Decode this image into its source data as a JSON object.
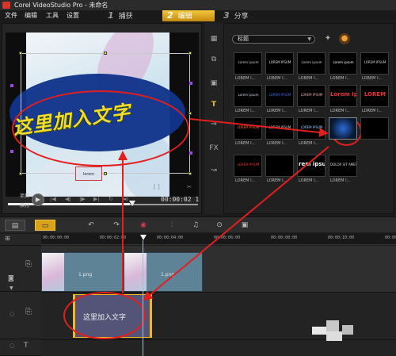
{
  "window": {
    "title": "Corel VideoStudio Pro - 未命名"
  },
  "menu": {
    "items": [
      "文件",
      "编辑",
      "工具",
      "设置"
    ]
  },
  "steps": [
    {
      "num": "1",
      "label": "捕获"
    },
    {
      "num": "2",
      "label": "编辑"
    },
    {
      "num": "3",
      "label": "分享"
    }
  ],
  "preview": {
    "overlay_text": "这里加入文字",
    "small_box_text": "lorem",
    "mode_project": "项目",
    "mode_clip": "素材",
    "timecode": "00:00:02 1"
  },
  "library": {
    "category": "标题",
    "thumbnails": [
      {
        "text": "Lorem ipsum",
        "label": "LOREM I..."
      },
      {
        "text": "LOREM IPSUM",
        "label": "LOREM I..."
      },
      {
        "text": "Lorem ipsum",
        "label": "LOREM I..."
      },
      {
        "text": "Lorem ipsum",
        "label": "LOREM I..."
      },
      {
        "text": "LOREM IPSUM",
        "label": "LOREM I..."
      },
      {
        "text": "Lorem ipsum",
        "label": "LOREM I..."
      },
      {
        "text": "LOREM IPSUM",
        "label": "LOREM I..."
      },
      {
        "text": "LOREM IPSUM",
        "label": "LOREM I..."
      },
      {
        "text": "Lorem Ipsum",
        "label": "LOREM I..."
      },
      {
        "text": "LOREM",
        "label": "LOREM I..."
      },
      {
        "text": "LOREM IPSUM",
        "label": "LOREM I..."
      },
      {
        "text": "LOREM IPSUM",
        "label": "LOREM I..."
      },
      {
        "text": "LOREM IPSUM",
        "label": "LOREM I..."
      },
      {
        "text": "",
        "label": ""
      },
      {
        "text": "",
        "label": ""
      },
      {
        "text": "LOREM IPSUM",
        "label": "LOREM I..."
      },
      {
        "text": "",
        "label": "LOREM I..."
      },
      {
        "text": "rem ipsu OR SIT A",
        "label": "LOREM I..."
      },
      {
        "text": "DOLOR SIT AMET",
        "label": "LOREM I..."
      }
    ]
  },
  "timeline": {
    "ruler_ticks": [
      "00:00:00:00",
      "00:00:02:00",
      "00:00:04:00",
      "00:00:06:00",
      "00:00:08:00",
      "00:00:10:00",
      "00:00:12:00"
    ],
    "video_clips": [
      {
        "label": "1.png"
      },
      {
        "label": "1.png"
      }
    ],
    "title_clip_label": "这里加入文字"
  },
  "colors": {
    "accent": "#f4b81d",
    "annotation_red": "#e21e1e",
    "title_clip": "#545478",
    "video_clip": "#5e8296"
  },
  "icons": {
    "side": [
      "media-icon",
      "transition-icon",
      "title-icon",
      "graphic-icon",
      "filter-icon",
      "path-icon"
    ],
    "toolbar": [
      "storyboard-icon",
      "timeline-icon",
      "undo-icon",
      "redo-icon",
      "record-icon",
      "audio-mix-icon",
      "music-icon",
      "chapter-icon",
      "zoom-fit-icon"
    ]
  }
}
